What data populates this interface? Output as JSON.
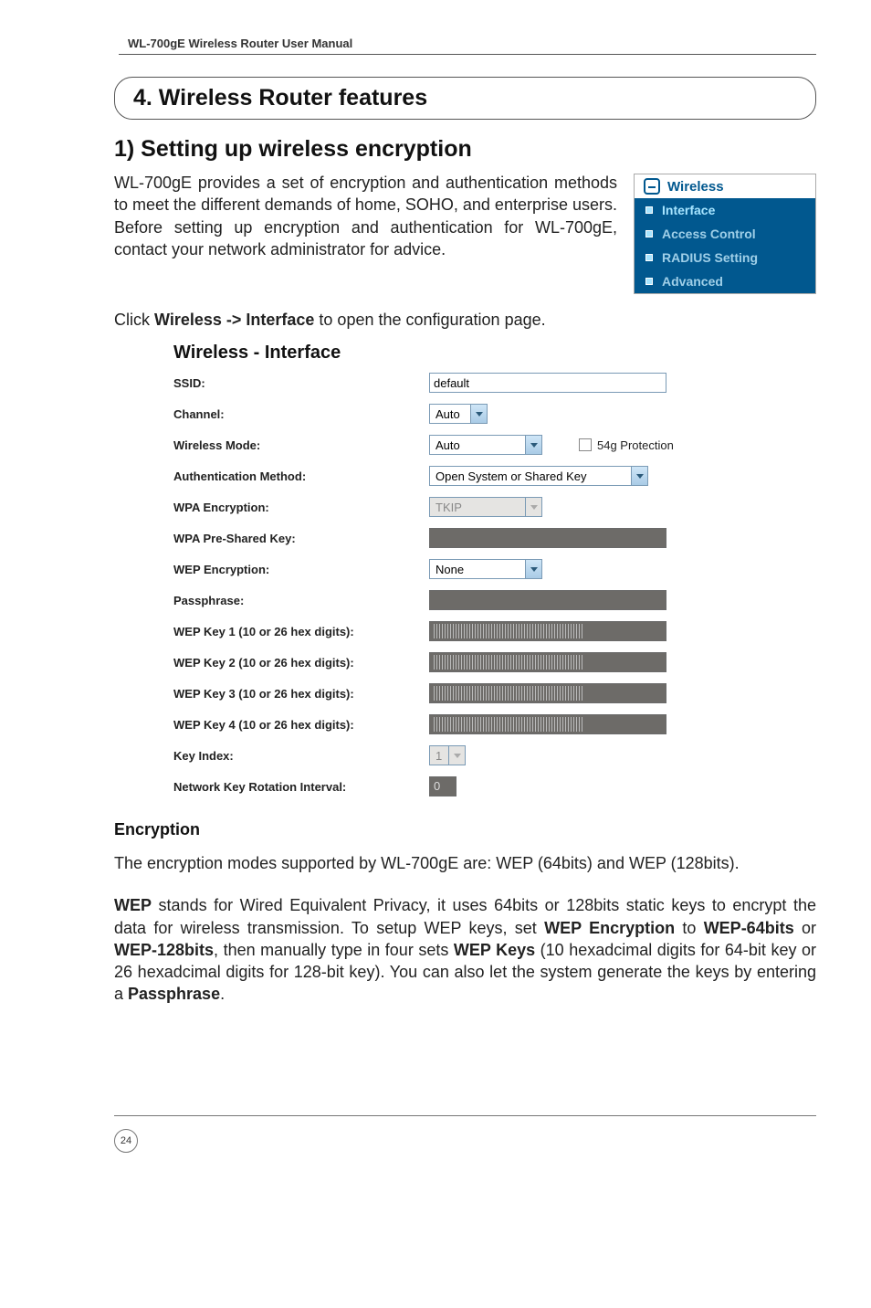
{
  "header": {
    "manual_title": "WL-700gE Wireless Router User Manual"
  },
  "section": {
    "title": "4. Wireless Router features",
    "subsection_title": "1) Setting up wireless encryption",
    "intro_text": "WL-700gE provides a set of encryption and authentication methods to meet the different demands of home, SOHO, and enterprise users. Before setting up encryption and authentication for WL-700gE, contact your network administrator for advice.",
    "click_hint_prefix": "Click ",
    "click_hint_bold": "Wireless -> Interface",
    "click_hint_suffix": " to open the configuration page."
  },
  "nav": {
    "header": "Wireless",
    "items": [
      {
        "label": "Interface"
      },
      {
        "label": "Access Control"
      },
      {
        "label": "RADIUS Setting"
      },
      {
        "label": "Advanced"
      }
    ]
  },
  "panel": {
    "title": "Wireless - Interface",
    "rows": {
      "ssid_label": "SSID:",
      "ssid_value": "default",
      "channel_label": "Channel:",
      "channel_value": "Auto",
      "wmode_label": "Wireless Mode:",
      "wmode_value": "Auto",
      "protect_label": "54g Protection",
      "auth_label": "Authentication Method:",
      "auth_value": "Open System or Shared Key",
      "wpaenc_label": "WPA Encryption:",
      "wpaenc_value": "TKIP",
      "wpapsk_label": "WPA Pre-Shared Key:",
      "wepenc_label": "WEP Encryption:",
      "wepenc_value": "None",
      "pass_label": "Passphrase:",
      "key1_label": "WEP Key 1 (10 or 26 hex digits):",
      "key2_label": "WEP Key 2 (10 or 26 hex digits):",
      "key3_label": "WEP Key 3 (10 or 26 hex digits):",
      "key4_label": "WEP Key 4 (10 or 26 hex digits):",
      "keyidx_label": "Key Index:",
      "keyidx_value": "1",
      "rot_label": "Network Key Rotation Interval:",
      "rot_value": "0"
    }
  },
  "encryption": {
    "heading": "Encryption",
    "p1": "The encryption modes supported by WL-700gE are: WEP (64bits) and WEP (128bits).",
    "p2_parts": {
      "a": "WEP",
      "b": " stands for Wired Equivalent Privacy, it uses 64bits or 128bits static keys to encrypt the data for wireless transmission. To setup WEP keys, set ",
      "c": "WEP Encryption",
      "d": " to ",
      "e": "WEP-64bits",
      "f": " or ",
      "g": "WEP-128bits",
      "h": ", then manually type in four sets ",
      "i": "WEP Keys",
      "j": " (10 hexadcimal digits for 64-bit key or 26 hexadcimal digits for 128-bit key). You can also let the system generate the keys by entering a ",
      "k": "Passphrase",
      "l": "."
    }
  },
  "footer": {
    "page_number": "24"
  }
}
